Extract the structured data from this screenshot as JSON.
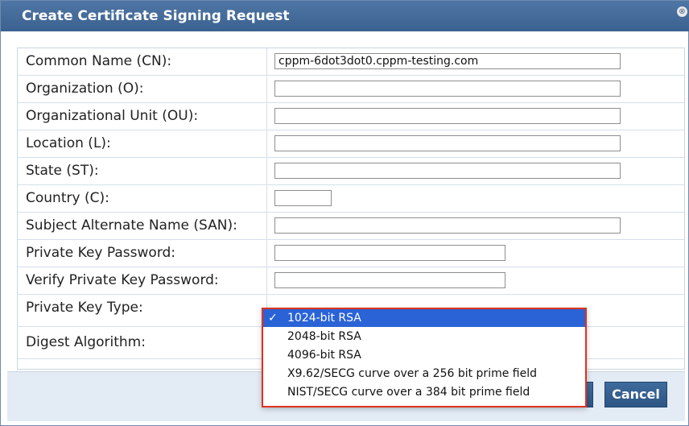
{
  "dialog": {
    "title": "Create Certificate Signing Request",
    "close_icon_glyph": "⊗"
  },
  "form": {
    "rows": [
      {
        "label": "Common Name (CN):",
        "value": "cppm-6dot3dot0.cppm-testing.com"
      },
      {
        "label": "Organization (O):",
        "value": ""
      },
      {
        "label": "Organizational Unit (OU):",
        "value": ""
      },
      {
        "label": "Location (L):",
        "value": ""
      },
      {
        "label": "State (ST):",
        "value": ""
      },
      {
        "label": "Country (C):",
        "value": ""
      },
      {
        "label": "Subject Alternate Name (SAN):",
        "value": ""
      },
      {
        "label": "Private Key Password:",
        "value": ""
      },
      {
        "label": "Verify Private Key Password:",
        "value": ""
      },
      {
        "label": "Private Key Type:"
      },
      {
        "label": "Digest Algorithm:"
      }
    ]
  },
  "key_type_dropdown": {
    "check_glyph": "✓",
    "options": [
      "1024-bit RSA",
      "2048-bit RSA",
      "4096-bit RSA",
      "X9.62/SECG curve over a 256 bit prime field",
      "NIST/SECG curve over a 384 bit prime field"
    ],
    "selected_index": 0
  },
  "footer": {
    "cancel_label": "Cancel"
  },
  "colors": {
    "title_bar": "#3b6190",
    "button": "#2c5583",
    "selected_option": "#2a63d6",
    "dropdown_border": "#e0321c",
    "footer_bg": "#e3ebf5"
  },
  "icons": {
    "close": "close-icon",
    "check": "checkmark-icon"
  }
}
